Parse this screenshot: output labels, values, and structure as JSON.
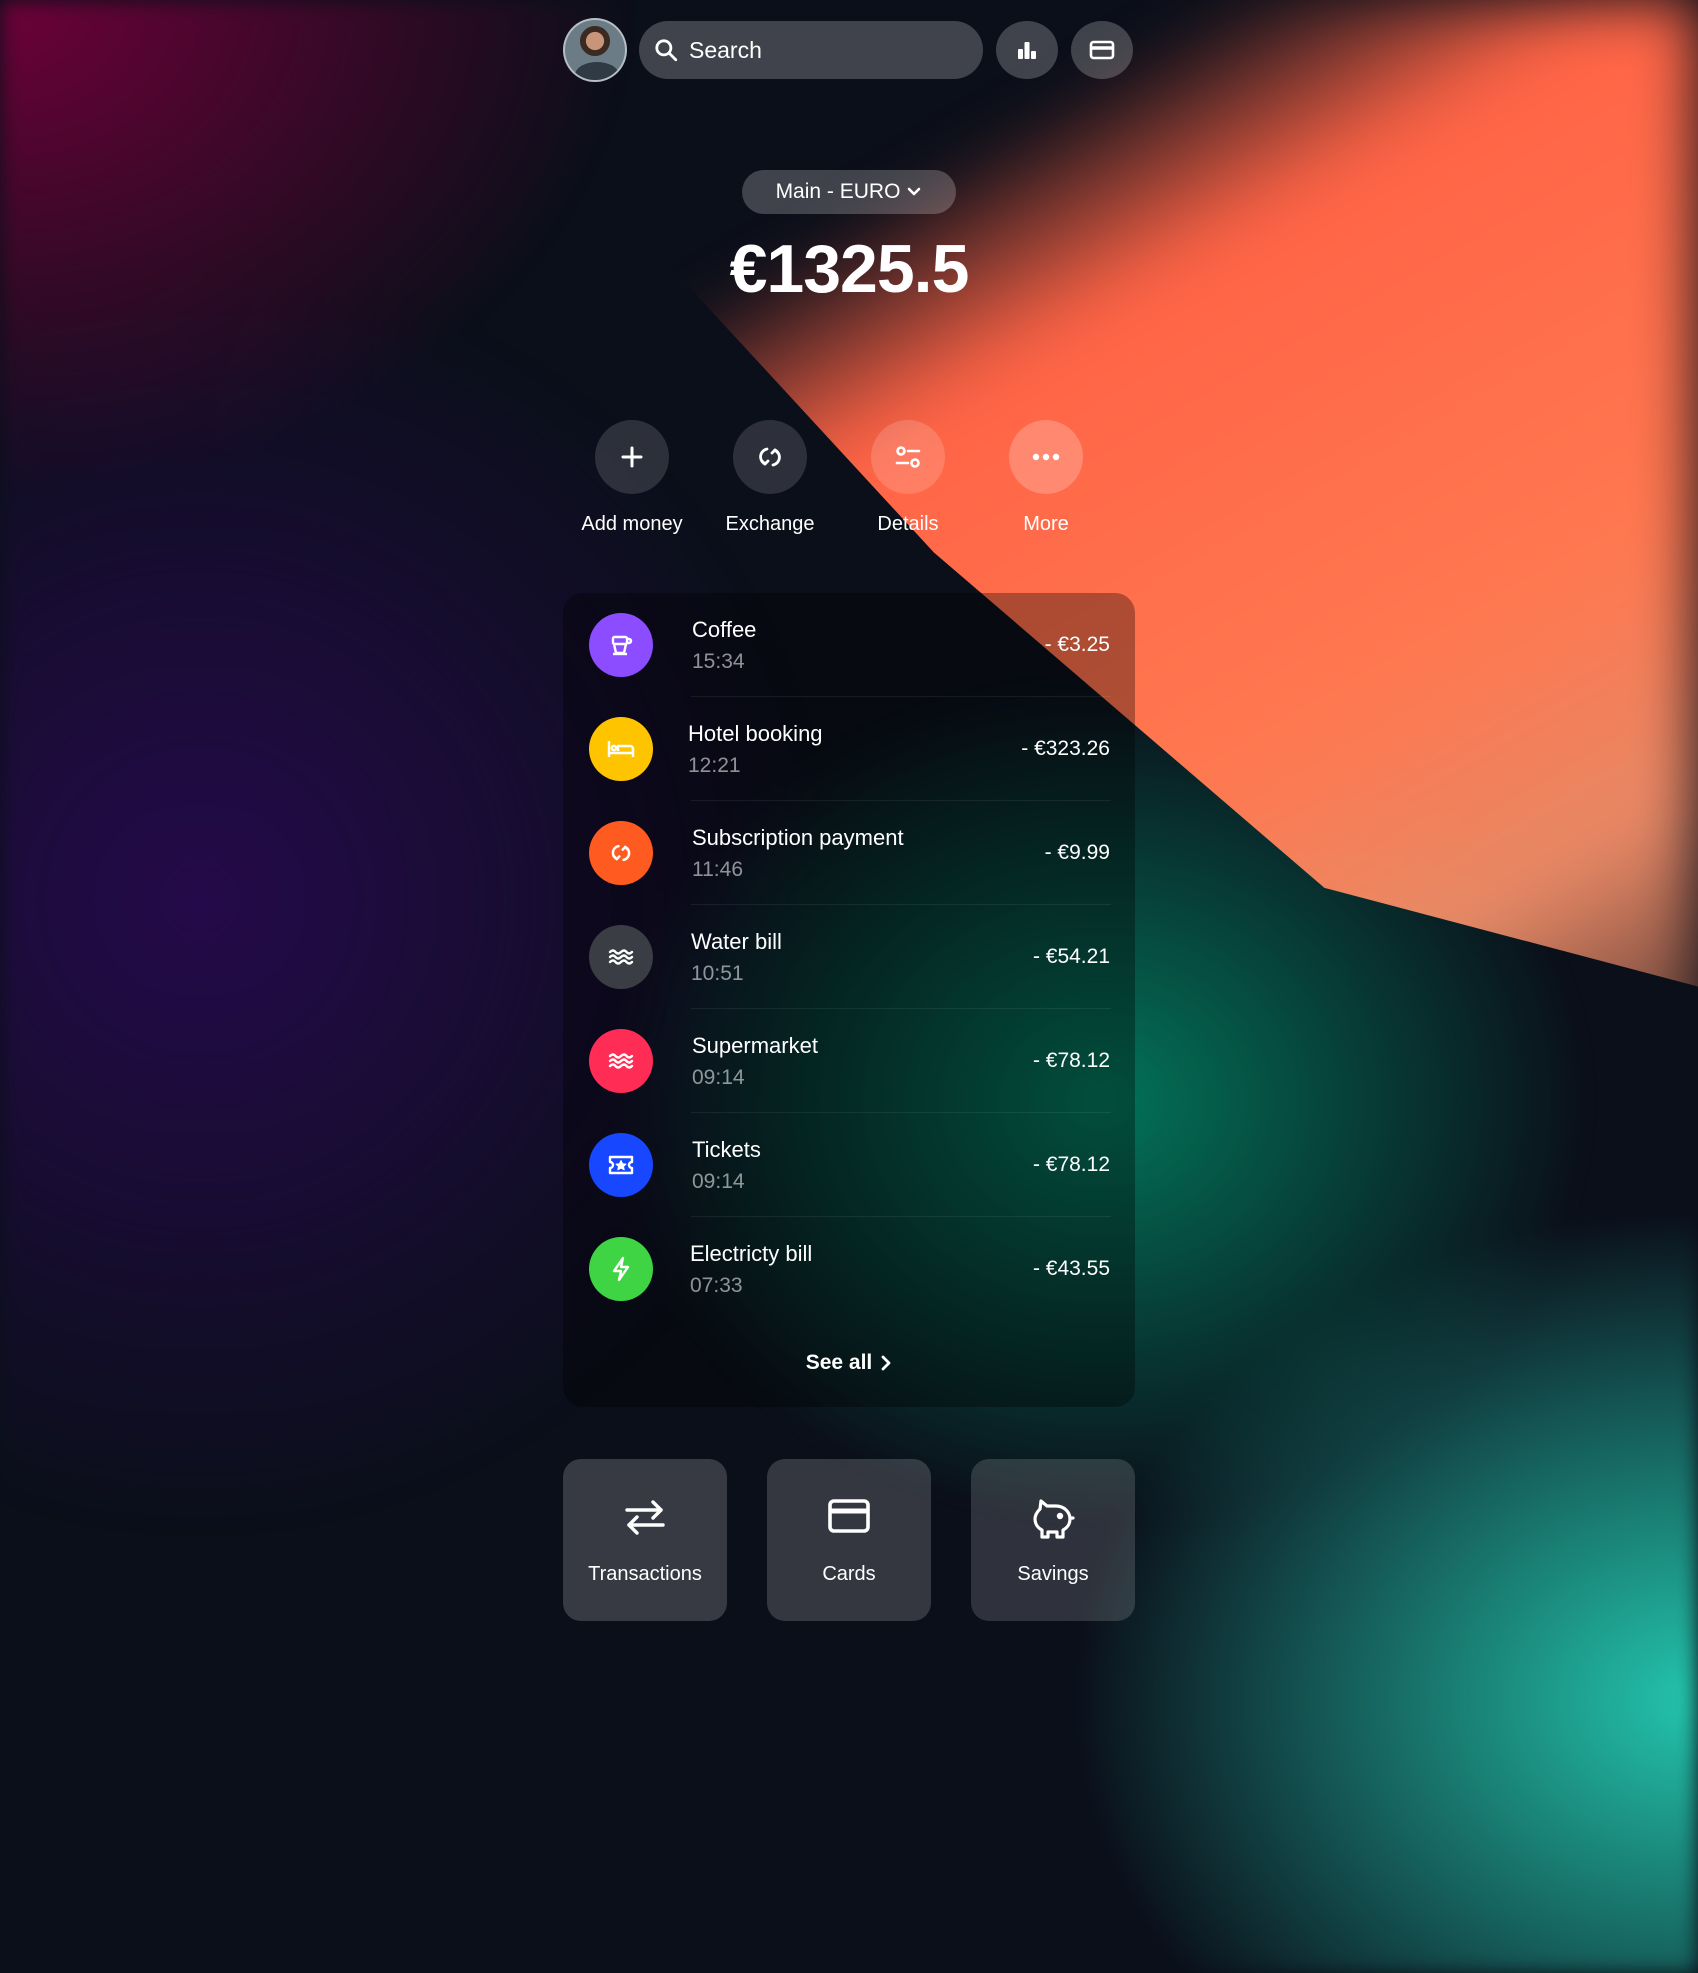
{
  "header": {
    "search_placeholder": "Search",
    "icons": [
      "avatar",
      "search-icon",
      "bar-chart-icon",
      "credit-card-icon"
    ]
  },
  "account": {
    "selector_label": "Main - EURO",
    "balance": "€1325.5"
  },
  "actions": [
    {
      "label": "Add money",
      "icon": "plus-icon"
    },
    {
      "label": "Exchange",
      "icon": "exchange-icon"
    },
    {
      "label": "Details",
      "icon": "details-icon"
    },
    {
      "label": "More",
      "icon": "more-icon"
    }
  ],
  "transactions": [
    {
      "name": "Coffee",
      "time": "15:34",
      "amount": "- €3.25",
      "icon": "coffee-cup-icon",
      "color": "#8b4dff"
    },
    {
      "name": "Hotel booking",
      "time": "12:21",
      "amount": "- €323.26",
      "icon": "bed-icon",
      "color": "#ffc400"
    },
    {
      "name": "Subscription payment",
      "time": "11:46",
      "amount": "- €9.99",
      "icon": "repeat-icon",
      "color": "#ff5a1f"
    },
    {
      "name": "Water bill",
      "time": "10:51",
      "amount": "- €54.21",
      "icon": "waves-icon",
      "color": "#3a3d44"
    },
    {
      "name": "Supermarket",
      "time": "09:14",
      "amount": "- €78.12",
      "icon": "waves-icon",
      "color": "#ff2d55"
    },
    {
      "name": "Tickets",
      "time": "09:14",
      "amount": "- €78.12",
      "icon": "ticket-icon",
      "color": "#1747ff"
    },
    {
      "name": "Electricty bill",
      "time": "07:33",
      "amount": "- €43.55",
      "icon": "lightning-icon",
      "color": "#3ed443"
    }
  ],
  "see_all_label": "See all",
  "tiles": [
    {
      "label": "Transactions",
      "icon": "swap-arrows-icon"
    },
    {
      "label": "Cards",
      "icon": "credit-card-icon"
    },
    {
      "label": "Savings",
      "icon": "piggy-bank-icon"
    }
  ]
}
